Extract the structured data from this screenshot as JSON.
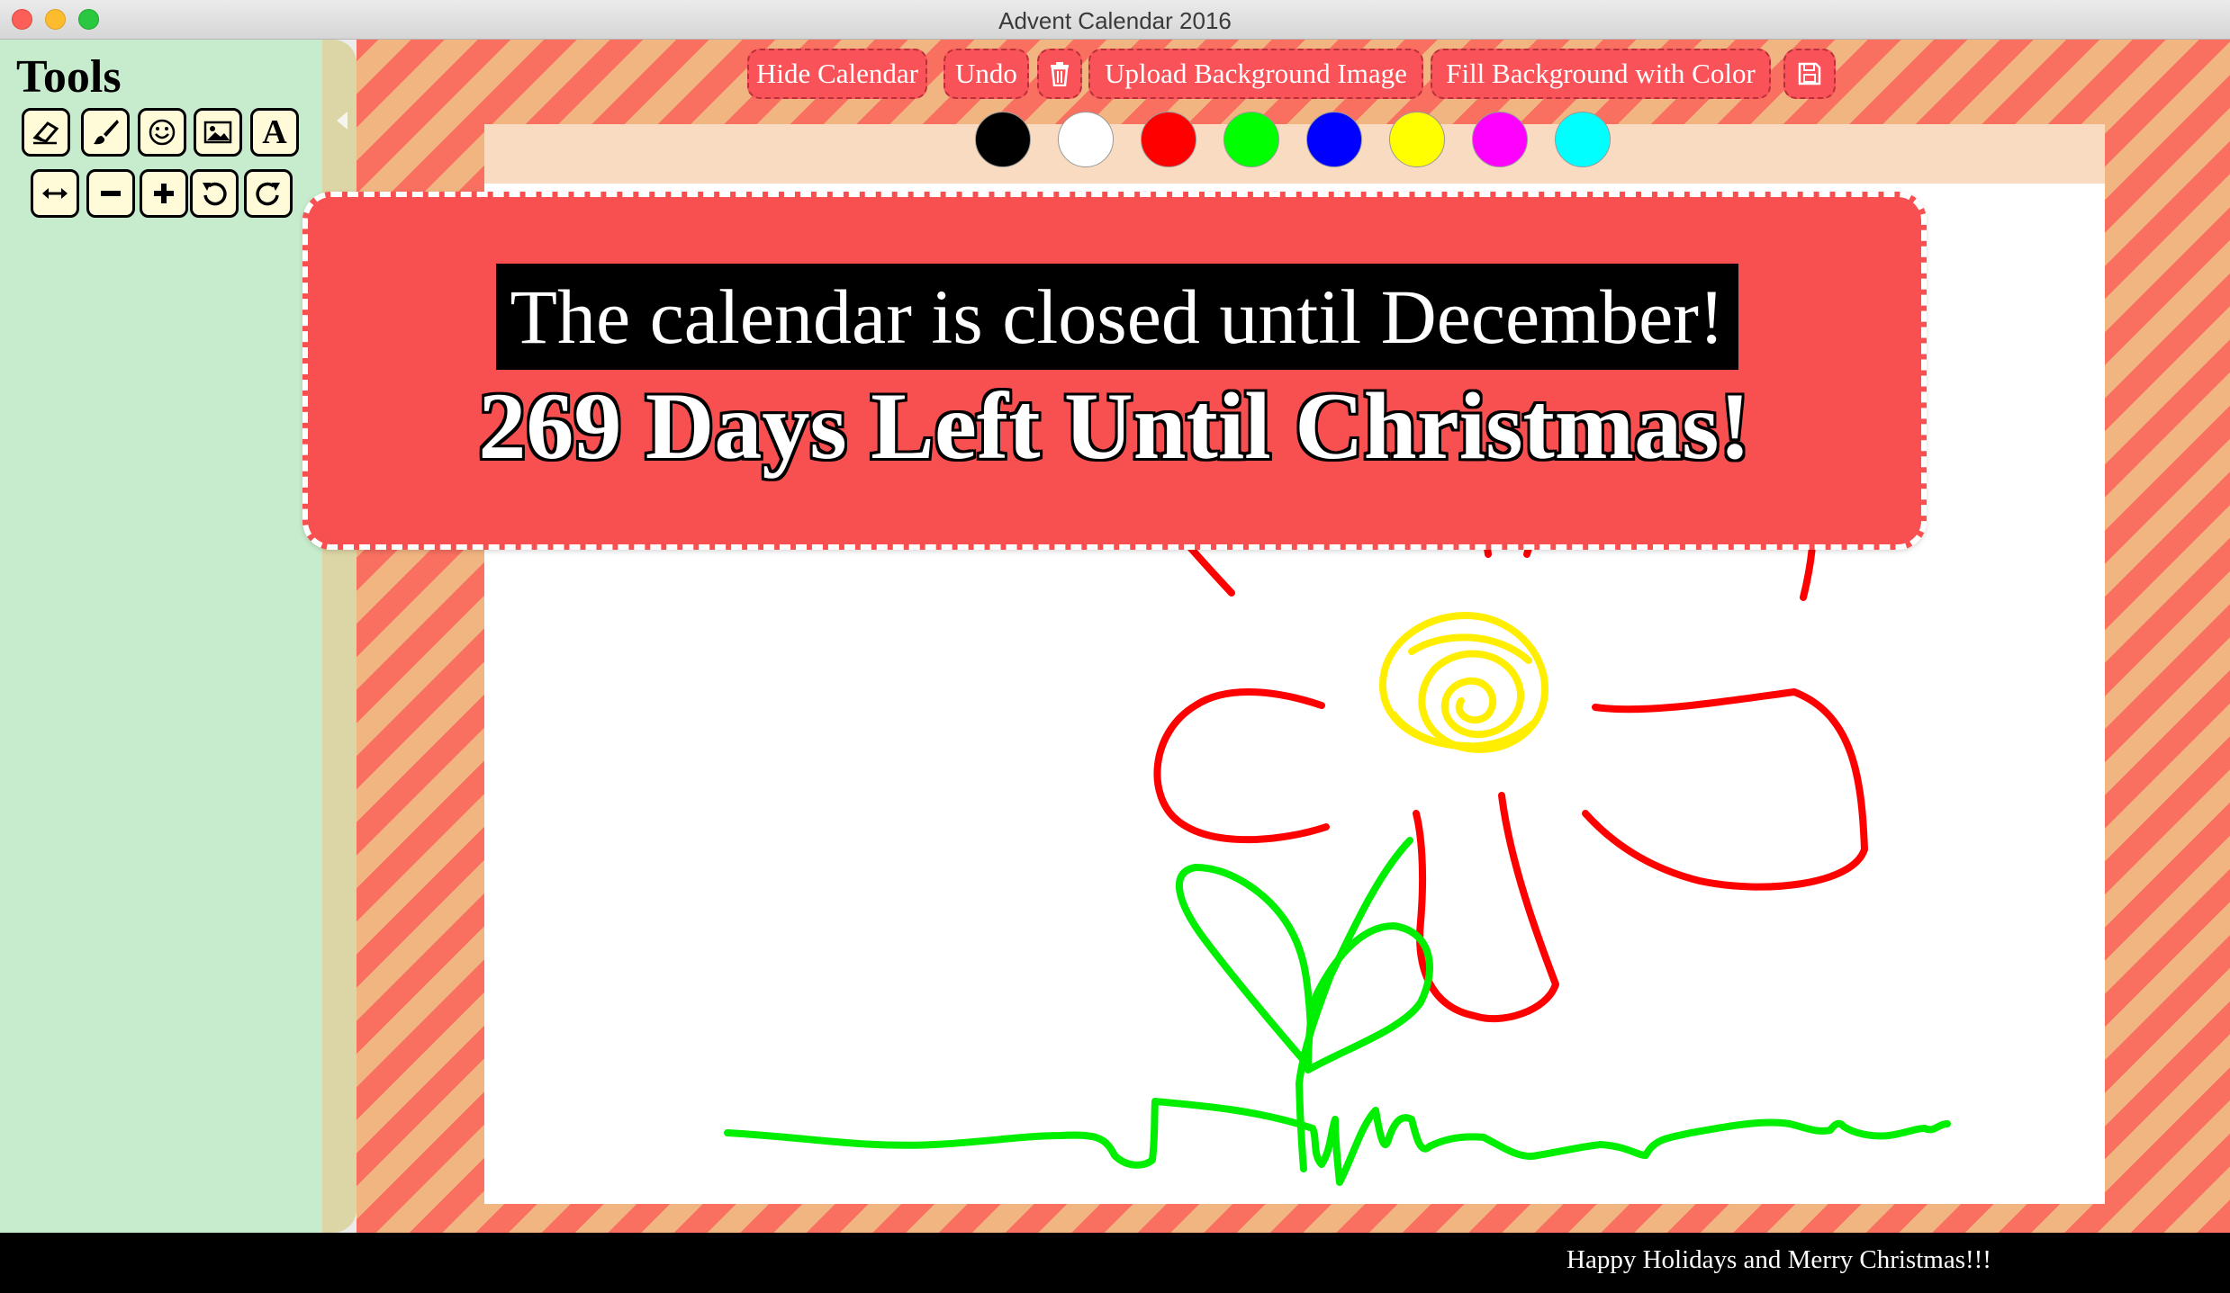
{
  "window": {
    "title": "Advent Calendar 2016"
  },
  "sidebar": {
    "title": "Tools",
    "tools_row1": [
      "eraser-icon",
      "brush-icon",
      "smiley-icon",
      "image-icon",
      "text-icon"
    ],
    "tools_row2": [
      "resize-horizontal-icon",
      "minus-icon",
      "plus-icon",
      "rotate-left-icon",
      "rotate-right-icon"
    ],
    "text_tool_label": "A"
  },
  "toolbar": {
    "hide_calendar": "Hide Calendar",
    "undo": "Undo",
    "delete_icon": "trash-icon",
    "upload_background": "Upload Background Image",
    "fill_background": "Fill Background with Color",
    "save_icon": "floppy-disk-icon"
  },
  "palette": {
    "colors": [
      "#000000",
      "#ffffff",
      "#ff0000",
      "#00ff00",
      "#0000ff",
      "#ffff00",
      "#ff00ff",
      "#00ffff"
    ]
  },
  "banner": {
    "message": "The calendar is closed until December!",
    "countdown": "269 Days Left Until Christmas!"
  },
  "footer": {
    "text": "Happy Holidays and Merry Christmas!!!"
  },
  "colors": {
    "sidebar_bg": "#c7eccd",
    "banner_bg": "#f85050",
    "button_bg": "#f95258",
    "stripe_red": "#f97060",
    "stripe_peach": "#f1b582",
    "drawing_red": "#ff0000",
    "drawing_green": "#00ee00",
    "drawing_yellow": "#ffee00"
  }
}
